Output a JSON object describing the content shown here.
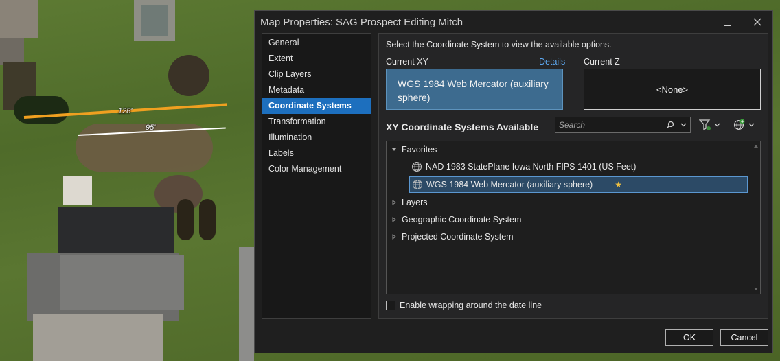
{
  "map": {
    "measurement_1": "128'",
    "measurement_2": "95'"
  },
  "dialog": {
    "title": "Map Properties: SAG Prospect Editing Mitch",
    "nav": [
      {
        "label": "General"
      },
      {
        "label": "Extent"
      },
      {
        "label": "Clip Layers"
      },
      {
        "label": "Metadata"
      },
      {
        "label": "Coordinate Systems",
        "selected": true
      },
      {
        "label": "Transformation"
      },
      {
        "label": "Illumination"
      },
      {
        "label": "Labels"
      },
      {
        "label": "Color Management"
      }
    ],
    "instruction": "Select the Coordinate System to view the available options.",
    "current_xy_label": "Current XY",
    "details_link": "Details",
    "current_xy_value": "WGS 1984 Web Mercator (auxiliary sphere)",
    "current_z_label": "Current Z",
    "current_z_value": "<None>",
    "available_label": "XY Coordinate Systems Available",
    "search_placeholder": "Search",
    "tree": {
      "favorites": "Favorites",
      "fav_items": [
        "NAD 1983 StatePlane Iowa North FIPS 1401 (US Feet)",
        "WGS 1984 Web Mercator (auxiliary sphere)"
      ],
      "layers": "Layers",
      "geographic": "Geographic Coordinate System",
      "projected": "Projected Coordinate System"
    },
    "wrap_label": "Enable wrapping around the date line",
    "ok_label": "OK",
    "cancel_label": "Cancel",
    "colors": {
      "accent": "#1d6fbe",
      "current_xy_bg": "#3d6b8f",
      "link": "#5da8f0",
      "favorite_star": "#f0c040",
      "measure_line": "#f0a020"
    }
  }
}
